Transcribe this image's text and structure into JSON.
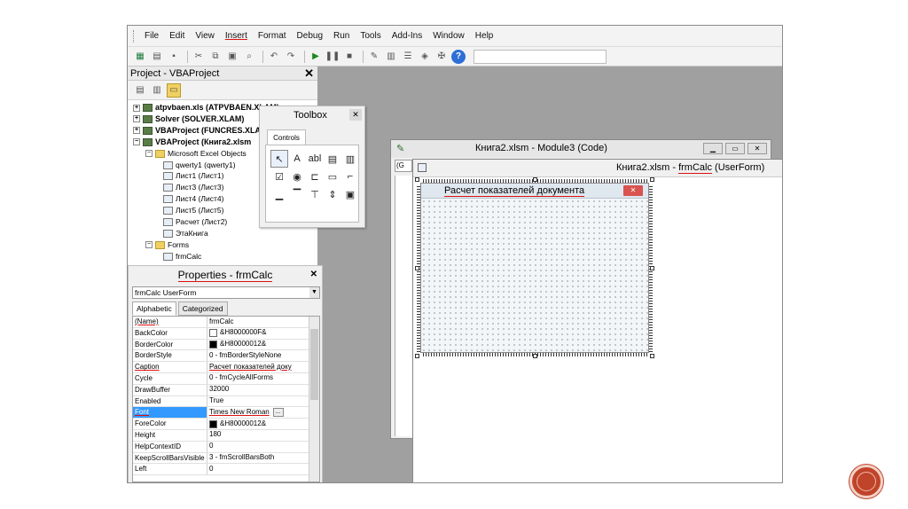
{
  "menu": {
    "items": [
      {
        "label": "File",
        "marked": false
      },
      {
        "label": "Edit",
        "marked": false
      },
      {
        "label": "View",
        "marked": false
      },
      {
        "label": "Insert",
        "marked": true
      },
      {
        "label": "Format",
        "marked": false
      },
      {
        "label": "Debug",
        "marked": false
      },
      {
        "label": "Run",
        "marked": false
      },
      {
        "label": "Tools",
        "marked": false
      },
      {
        "label": "Add-Ins",
        "marked": false
      },
      {
        "label": "Window",
        "marked": false
      },
      {
        "label": "Help",
        "marked": false
      }
    ]
  },
  "toolbar": {
    "icons": [
      "excel-icon",
      "insert-userform-icon",
      "save-icon",
      "cut-icon",
      "copy-icon",
      "paste-icon",
      "find-icon",
      "undo-icon",
      "redo-icon",
      "run-icon",
      "break-icon",
      "reset-icon",
      "design-mode-icon",
      "project-explorer-icon",
      "properties-window-icon",
      "object-browser-icon",
      "toolbox-icon",
      "help-icon"
    ]
  },
  "project": {
    "title": "Project - VBAProject",
    "close": "✕",
    "tree": [
      {
        "label": "atpvbaen.xls (ATPVBAEN.XLAM)",
        "bold": true,
        "expander": "+",
        "icon": "proj"
      },
      {
        "label": "Solver (SOLVER.XLAM)",
        "bold": true,
        "expander": "+",
        "icon": "proj"
      },
      {
        "label": "VBAProject (FUNCRES.XLA",
        "bold": true,
        "expander": "+",
        "icon": "proj"
      },
      {
        "label": "VBAProject (Книга2.xlsm",
        "bold": true,
        "expander": "−",
        "icon": "proj"
      },
      {
        "label": "Microsoft Excel Objects",
        "bold": false,
        "expander": "−",
        "icon": "folder"
      },
      {
        "label": "qwerty1 (qwerty1)",
        "bold": false,
        "expander": "",
        "icon": "sheet"
      },
      {
        "label": "Лист1 (Лист1)",
        "bold": false,
        "expander": "",
        "icon": "sheet"
      },
      {
        "label": "Лист3 (Лист3)",
        "bold": false,
        "expander": "",
        "icon": "sheet"
      },
      {
        "label": "Лист4 (Лист4)",
        "bold": false,
        "expander": "",
        "icon": "sheet"
      },
      {
        "label": "Лист5 (Лист5)",
        "bold": false,
        "expander": "",
        "icon": "sheet"
      },
      {
        "label": "Расчет (Лист2)",
        "bold": false,
        "expander": "",
        "icon": "sheet"
      },
      {
        "label": "ЭтаКнига",
        "bold": false,
        "expander": "",
        "icon": "sheet"
      },
      {
        "label": "Forms",
        "bold": false,
        "expander": "−",
        "icon": "folder"
      },
      {
        "label": "frmCalc",
        "bold": false,
        "expander": "",
        "icon": "form"
      }
    ]
  },
  "toolbox": {
    "title": "Toolbox",
    "close": "✕",
    "tab": "Controls",
    "tools": [
      "↖",
      "A",
      "abl",
      "▤",
      "▥",
      "☑",
      "◉",
      "⊏",
      "▭",
      "⌐",
      "▁",
      "▔",
      "⊤",
      "⇕",
      "▣"
    ]
  },
  "properties": {
    "title_prefix": "Properties - ",
    "title_object": "frmCalc",
    "close": "✕",
    "combo": "frmCalc UserForm",
    "tabs": [
      "Alphabetic",
      "Categorized"
    ],
    "rows": [
      {
        "name": "(Name)",
        "value": "frmCalc",
        "marked": true,
        "swatch": ""
      },
      {
        "name": "BackColor",
        "value": "&H8000000F&",
        "marked": false,
        "swatch": "#ffffff"
      },
      {
        "name": "BorderColor",
        "value": "&H80000012&",
        "marked": false,
        "swatch": "#000000"
      },
      {
        "name": "BorderStyle",
        "value": "0 - fmBorderStyleNone",
        "marked": false,
        "swatch": ""
      },
      {
        "name": "Caption",
        "value": "Расчет показателей доку",
        "marked": true,
        "swatch": ""
      },
      {
        "name": "Cycle",
        "value": "0 - fmCycleAllForms",
        "marked": false,
        "swatch": ""
      },
      {
        "name": "DrawBuffer",
        "value": "32000",
        "marked": false,
        "swatch": ""
      },
      {
        "name": "Enabled",
        "value": "True",
        "marked": false,
        "swatch": ""
      },
      {
        "name": "Font",
        "value": "Times New Roman",
        "marked": true,
        "swatch": "",
        "selected": true
      },
      {
        "name": "ForeColor",
        "value": "&H80000012&",
        "marked": false,
        "swatch": "#000000"
      },
      {
        "name": "Height",
        "value": "180",
        "marked": false,
        "swatch": ""
      },
      {
        "name": "HelpContextID",
        "value": "0",
        "marked": false,
        "swatch": ""
      },
      {
        "name": "KeepScrollBarsVisible",
        "value": "3 - fmScrollBarsBoth",
        "marked": false,
        "swatch": ""
      },
      {
        "name": "Left",
        "value": "0",
        "marked": false,
        "swatch": ""
      }
    ]
  },
  "code_window": {
    "title": "Книга2.xlsm - Module3 (Code)",
    "combo": "(G",
    "buttons": [
      "▁",
      "▭",
      "✕"
    ]
  },
  "userform_window": {
    "title_prefix": "Книга2.xlsm - ",
    "title_object": "frmCalc",
    "title_suffix": " (UserForm)"
  },
  "form": {
    "caption": "Расчет показателей документа",
    "close": "✕"
  },
  "colors": {
    "annotation_red": "#dd1111",
    "selection_blue": "#3399ff",
    "nav_button": "#c0442a"
  }
}
